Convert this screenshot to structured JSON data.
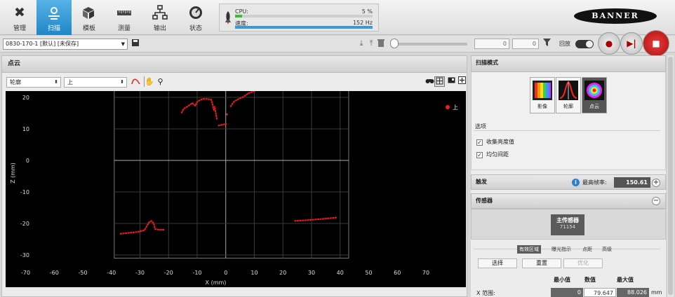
{
  "nav": {
    "items": [
      {
        "label": "管理",
        "icon": "wrench-icon"
      },
      {
        "label": "扫描",
        "icon": "scan-icon"
      },
      {
        "label": "模板",
        "icon": "cubes-icon"
      },
      {
        "label": "测量",
        "icon": "ruler-icon"
      },
      {
        "label": "输出",
        "icon": "network-icon"
      },
      {
        "label": "状态",
        "icon": "gauge-icon"
      }
    ]
  },
  "status": {
    "cpu_label": "CPU:",
    "cpu_value": "5 %",
    "cpu_fraction": 0.05,
    "speed_label": "速度:",
    "speed_value": "152 Hz",
    "speed_fraction": 1.0,
    "colors": {
      "cpu": "#35c12e",
      "speed": "#3a99d9"
    }
  },
  "logo": {
    "text": "BANNER"
  },
  "toolbar": {
    "config": "0830-170-1 [默认] [未保存]",
    "frame_current": "0",
    "frame_total": "0",
    "playback_label": "回放"
  },
  "pointcloud": {
    "title": "点云",
    "view_select": "轮廓",
    "direction_select": "上"
  },
  "chart_data": {
    "type": "scatter",
    "xlabel": "X (mm)",
    "ylabel": "Z (mm)",
    "xlim": [
      -77,
      84
    ],
    "ylim": [
      -34,
      22
    ],
    "xticks": [
      -70,
      -60,
      -50,
      -40,
      -30,
      -20,
      -10,
      0,
      10,
      20,
      30,
      40,
      50,
      60,
      70
    ],
    "yticks": [
      20,
      10,
      0,
      -10,
      -20,
      -30
    ],
    "grid_box": {
      "x": [
        -39,
        43
      ],
      "y": [
        -31,
        24
      ],
      "step": 10
    },
    "legend": {
      "label": "上",
      "position": "top-right"
    },
    "series": [
      {
        "name": "上",
        "color": "#ff1a1a",
        "segments": [
          [
            [
              -37,
              -23.3
            ],
            [
              -34,
              -23.0
            ],
            [
              -31,
              -22.7
            ],
            [
              -28.5,
              -22.2
            ],
            [
              -27.7,
              -21.0
            ],
            [
              -26.8,
              -19.6
            ],
            [
              -26,
              -19.2
            ],
            [
              -25.2,
              -20.0
            ],
            [
              -24.7,
              -21.8
            ],
            [
              -23,
              -22.0
            ],
            [
              -21.5,
              -22.0
            ]
          ],
          [
            [
              -15.5,
              15.0
            ],
            [
              -14.7,
              16.4
            ],
            [
              -13.2,
              17.2
            ],
            [
              -11.7,
              18.2
            ],
            [
              -10.6,
              17.3
            ],
            [
              -9.9,
              18.7
            ],
            [
              -8.1,
              19.5
            ],
            [
              -6.6,
              19.5
            ],
            [
              -5.1,
              19.3
            ],
            [
              -4.5,
              17.5
            ],
            [
              -4.1,
              15.7
            ]
          ],
          [
            [
              -3.1,
              13.0
            ],
            [
              -3.9,
              17.2
            ]
          ],
          [
            [
              -2.7,
              11.0
            ],
            [
              -1.2,
              11.3
            ],
            [
              0.3,
              11.6
            ]
          ],
          [
            [
              0.4,
              14.6
            ]
          ],
          [
            [
              1.6,
              17.0
            ],
            [
              2.9,
              18.7
            ],
            [
              4.5,
              19.5
            ],
            [
              6.2,
              20.2
            ],
            [
              8,
              21.3
            ],
            [
              10,
              22.0
            ],
            [
              12,
              22.7
            ],
            [
              14.5,
              23.0
            ]
          ],
          [
            [
              24,
              -19.2
            ],
            [
              28,
              -19.0
            ],
            [
              32,
              -18.7
            ],
            [
              36,
              -18.4
            ],
            [
              39,
              -18.1
            ]
          ]
        ]
      }
    ]
  },
  "scan_mode": {
    "title": "扫描模式",
    "modes": [
      {
        "label": "影像",
        "icon": "image-mode-icon"
      },
      {
        "label": "轮廓",
        "icon": "profile-mode-icon"
      },
      {
        "label": "点云",
        "icon": "pointcloud-mode-icon"
      }
    ],
    "options_label": "选项",
    "options": [
      {
        "label": "收集亮度值",
        "checked": true
      },
      {
        "label": "均匀间距",
        "checked": true
      }
    ]
  },
  "trigger": {
    "title": "触发",
    "rate_label": "最高帧率:",
    "rate_value": "150.61"
  },
  "sensor": {
    "title": "传感器",
    "card_label": "主传感器",
    "card_id": "71154",
    "tabs": [
      "有效区域",
      "曝光指示",
      "点距",
      "高级"
    ],
    "actions": [
      "选择",
      "重置",
      "优化"
    ],
    "headers": [
      "最小值",
      "数值",
      "最大值"
    ],
    "xrange_label": "X 范围:",
    "xrange_min": "0",
    "xrange_value": "79.647",
    "xrange_max": "88.026",
    "unit": "mm"
  }
}
